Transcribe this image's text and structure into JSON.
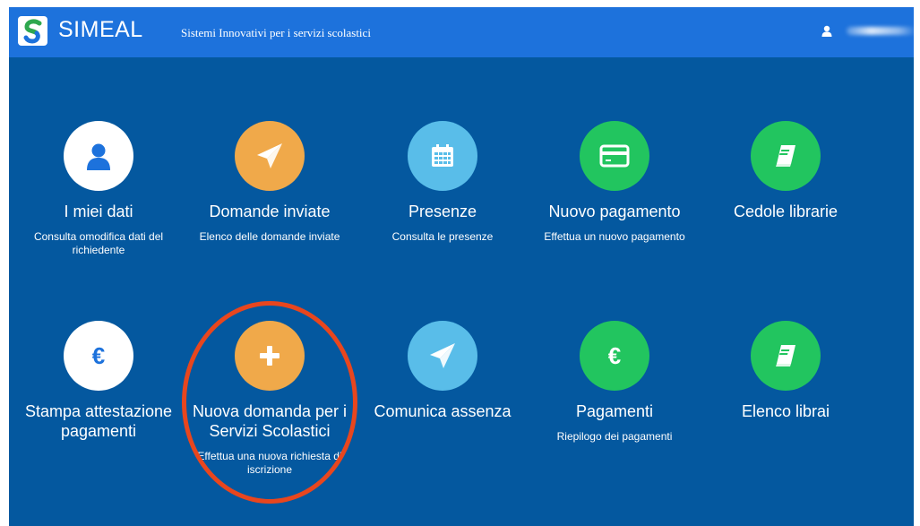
{
  "header": {
    "brand": "SIMEAL",
    "tagline": "Sistemi Innovativi per i servizi scolastici",
    "logo_icon": "simeal-logo-icon",
    "user_icon": "user-icon",
    "background": "#1d72dc"
  },
  "colors": {
    "page_background": "#04589f",
    "white": "#ffffff",
    "orange": "#f0a94a",
    "light_blue": "#59bde9",
    "green": "#22c55f",
    "highlight": "#e8461e"
  },
  "tiles": [
    {
      "title": "I miei dati",
      "desc": "Consulta omodifica dati del richiedente",
      "icon": "user-icon",
      "color": "white"
    },
    {
      "title": "Domande inviate",
      "desc": "Elenco delle domande inviate",
      "icon": "paper-plane-icon",
      "color": "orange"
    },
    {
      "title": "Presenze",
      "desc": "Consulta le presenze",
      "icon": "calendar-icon",
      "color": "light_blue"
    },
    {
      "title": "Nuovo pagamento",
      "desc": "Effettua un nuovo pagamento",
      "icon": "credit-card-icon",
      "color": "green"
    },
    {
      "title": "Cedole librarie",
      "desc": "",
      "icon": "book-icon",
      "color": "green"
    },
    {
      "title": "Stampa attestazione pagamenti",
      "desc": "",
      "icon": "euro-icon",
      "color": "white"
    },
    {
      "title": "Nuova domanda per i Servizi Scolastici",
      "desc": "Effettua una nuova richiesta di iscrizione",
      "icon": "plus-icon",
      "color": "orange",
      "highlighted": true
    },
    {
      "title": "Comunica assenza",
      "desc": "",
      "icon": "paper-plane-icon",
      "color": "light_blue"
    },
    {
      "title": "Pagamenti",
      "desc": "Riepilogo dei pagamenti",
      "icon": "euro-icon",
      "color": "green"
    },
    {
      "title": "Elenco librai",
      "desc": "",
      "icon": "book-icon",
      "color": "green"
    }
  ]
}
